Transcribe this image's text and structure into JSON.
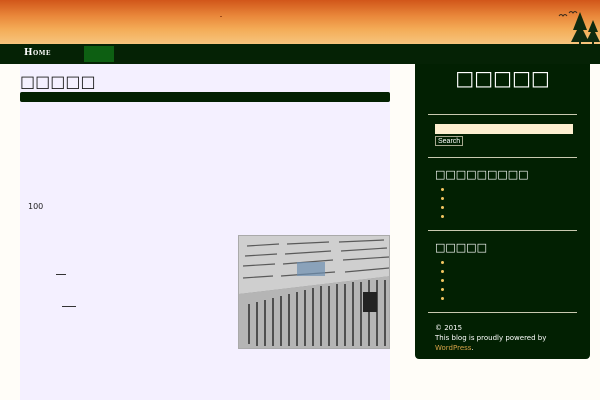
{
  "header": {
    "icons": [
      "birds-icon",
      "trees-icon"
    ]
  },
  "nav": {
    "items": [
      {
        "label": "Home"
      },
      {
        "label": ""
      }
    ]
  },
  "post": {
    "title": "□□□□□",
    "body_number": "100"
  },
  "sidebar": {
    "title": "□□□□□",
    "search_button": "Search",
    "search_value": "",
    "section1_heading": "□□□□□□□□□",
    "section2_heading": "□□□□□",
    "footer_copyright": "© 2015",
    "footer_text": "This blog is proudly powered by",
    "footer_link": "WordPress",
    "footer_period": "."
  },
  "colors": {
    "nav_bg": "#052205",
    "nav_active": "#0d5f12",
    "content_bg": "#f4f0ff",
    "sidebar_bg": "#022002",
    "bullet": "#f2c560",
    "link": "#d7a348"
  }
}
